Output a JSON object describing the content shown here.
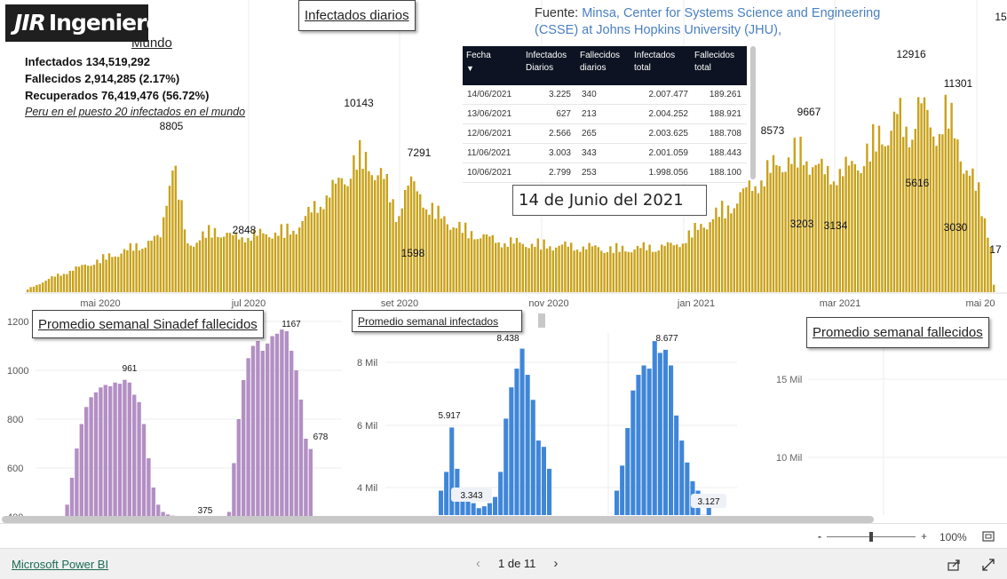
{
  "logo": {
    "brand": "Ingenieros",
    "mark": "JIR"
  },
  "main_chart": {
    "title": "Infectados diarios",
    "x_ticks": [
      "mai 2020",
      "jul 2020",
      "set 2020",
      "nov 2020",
      "jan 2021",
      "mar 2021",
      "mai 20"
    ],
    "labels": [
      "8805",
      "2848",
      "10143",
      "7291",
      "1598",
      "8573",
      "9667",
      "3203",
      "3134",
      "12916",
      "5616",
      "11301",
      "3030",
      "17",
      "15"
    ]
  },
  "world": {
    "heading": "Mundo",
    "infectados": "Infectados 134,519,292",
    "fallecidos": "Fallecidos 2,914,285 (2.17%)",
    "recuperados": "Recuperados 76,419,476 (56.72%)",
    "peru_note": "Peru en el puesto 20 infectados en el mundo"
  },
  "source": {
    "label": "Fuente: ",
    "text": "Minsa, Center for Systems Science and Engineering (CSSE) at Johns Hopkins University (JHU),"
  },
  "table": {
    "headers": [
      "Fecha",
      "Infectados Diarios",
      "Fallecidos diarios",
      "Infectados total",
      "Fallecidos total"
    ],
    "sort_indicator": "▼",
    "rows": [
      [
        "14/06/2021",
        "3.225",
        "340",
        "2.007.477",
        "189.261"
      ],
      [
        "13/06/2021",
        "627",
        "213",
        "2.004.252",
        "188.921"
      ],
      [
        "12/06/2021",
        "2.566",
        "265",
        "2.003.625",
        "188.708"
      ],
      [
        "11/06/2021",
        "3.003",
        "343",
        "2.001.059",
        "188.443"
      ],
      [
        "10/06/2021",
        "2.799",
        "253",
        "1.998.056",
        "188.100"
      ]
    ]
  },
  "date_box": "14 de Junio del 2021",
  "sinadef": {
    "title": "Promedio semanal Sinadef fallecidos",
    "y_ticks": [
      "1200",
      "1000",
      "800",
      "600",
      "400"
    ],
    "labels": [
      "961",
      "1167",
      "678",
      "375"
    ]
  },
  "infectados_semanal": {
    "title": "Promedio semanal infectados",
    "y_ticks": [
      "8 Mil",
      "6 Mil",
      "4 Mil"
    ],
    "labels": [
      "5.917",
      "8.438",
      "3.343",
      "8.677",
      "3.127"
    ]
  },
  "fallecidos_semanal": {
    "title": "Promedio semanal fallecidos",
    "y_ticks": [
      "15 Mil",
      "10 Mil"
    ]
  },
  "zoom": {
    "minus": "-",
    "plus": "+",
    "level": "100%"
  },
  "footer": {
    "brand": "Microsoft Power BI",
    "page": "1 de 11",
    "prev": "‹",
    "next": "›"
  },
  "colors": {
    "gold": "#c9a21a",
    "purple": "#b38fc4",
    "blue": "#3f86d9",
    "table_header": "#0d1322"
  }
}
